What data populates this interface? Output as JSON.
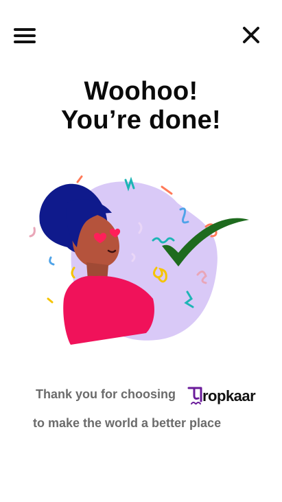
{
  "header": {
    "menu_icon": "hamburger-menu-icon",
    "close_icon": "close-icon"
  },
  "title": {
    "line1": "Woohoo!",
    "line2": "You’re done!"
  },
  "message": {
    "line1": "Thank you for choosing",
    "brand_name": "ropkaar",
    "line2": "to make the world a better place"
  },
  "colors": {
    "brand_purple": "#6a1b9a",
    "check_green": "#1e6b1e",
    "blob_lavender": "#d9c9f7",
    "shirt_pink": "#f0125a",
    "hair_navy": "#0f1a8c"
  }
}
